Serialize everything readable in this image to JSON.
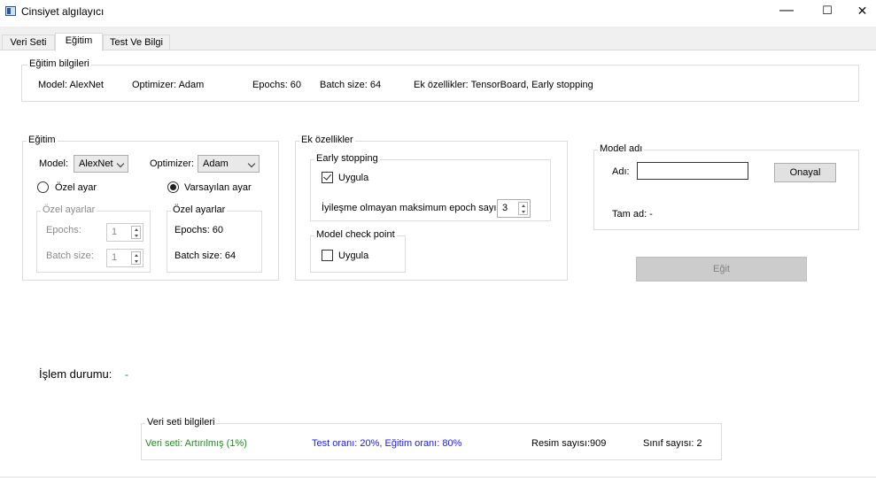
{
  "window": {
    "title": "Cinsiyet algılayıcı",
    "controls": {
      "minimize": "—",
      "maximize": "☐",
      "close": "✕"
    }
  },
  "tabs": [
    {
      "label": "Veri Seti",
      "active": false
    },
    {
      "label": "Eğitim",
      "active": true
    },
    {
      "label": "Test Ve Bilgi",
      "active": false
    }
  ],
  "training_info": {
    "title": "Eğitim bilgileri",
    "model": "Model: AlexNet",
    "optimizer": "Optimizer: Adam",
    "epochs": "Epochs: 60",
    "batch_size": "Batch size: 64",
    "extras": "Ek özellikler: TensorBoard, Early stopping"
  },
  "training": {
    "title": "Eğitim",
    "model_label": "Model:",
    "model_value": "AlexNet",
    "optimizer_label": "Optimizer:",
    "optimizer_value": "Adam",
    "custom_radio": {
      "label": "Özel ayar",
      "selected": false
    },
    "default_radio": {
      "label": "Varsayılan ayar",
      "selected": true
    },
    "custom_settings": {
      "title": "Özel ayarlar",
      "epochs_label": "Epochs:",
      "epochs_value": "1",
      "batch_label": "Batch size:",
      "batch_value": "1"
    },
    "default_settings": {
      "title": "Özel ayarlar",
      "epochs": "Epochs: 60",
      "batch_size": "Batch size: 64"
    }
  },
  "extra_features": {
    "title": "Ek özellikler",
    "early_stopping": {
      "title": "Early stopping",
      "apply_label": "Uygula",
      "apply_checked": true,
      "patience_label": "İyileşme olmayan maksimum epoch sayısı:",
      "patience_value": "3"
    },
    "checkpoint": {
      "title": "Model check point",
      "apply_label": "Uygula",
      "apply_checked": false
    }
  },
  "model_name": {
    "title": "Model adı",
    "name_label": "Adı:",
    "name_value": "",
    "confirm_button": "Onayal",
    "full_name": "Tam ad:  -"
  },
  "train_button": "Eğit",
  "status": {
    "label": "İşlem durumu:",
    "value": "-"
  },
  "dataset_info": {
    "title": "Veri seti bilgileri",
    "dataset": "Veri seti: Artırılmış (1%)",
    "ratio": "Test oranı: 20%, Eğitim oranı: 80%",
    "image_count": "Resim sayısı:909",
    "class_count": "Sınıf sayısı: 2"
  },
  "colors": {
    "green_text": "#1a8f1a",
    "blue_text": "#1a1aff",
    "disabled_button": "#cccccc"
  }
}
